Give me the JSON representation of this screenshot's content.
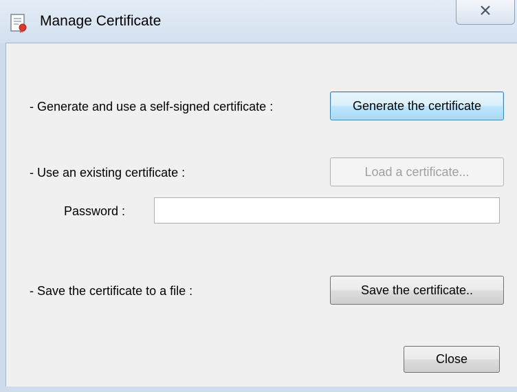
{
  "window": {
    "title": "Manage Certificate",
    "close_glyph": "✕",
    "app_icon": "certificate-document-icon"
  },
  "generate": {
    "label": "- Generate and use a self-signed certificate :",
    "button": "Generate the certificate"
  },
  "existing": {
    "label": "- Use an existing certificate :",
    "button": "Load a certificate...",
    "password_label": "Password :",
    "password_value": ""
  },
  "save": {
    "label": "- Save the certificate to a file :",
    "button": "Save the certificate.."
  },
  "footer": {
    "close_button": "Close"
  },
  "colors": {
    "default_button_border": "#3c7fb1",
    "disabled_text": "#a0a0a0",
    "dialog_background": "#f0f0f0"
  }
}
